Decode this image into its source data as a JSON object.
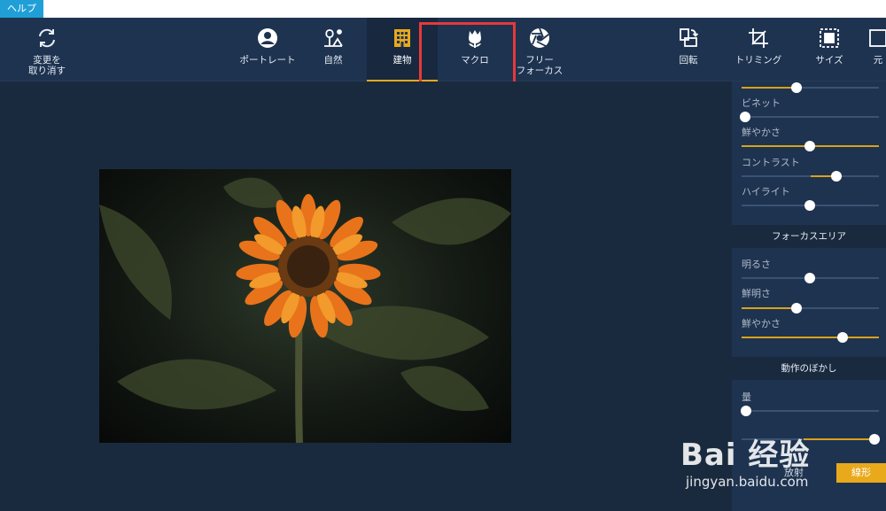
{
  "topbar": {
    "help_tab": "ヘルプ"
  },
  "toolbar": {
    "undo_label": "変更を\n取り消す",
    "tools": [
      {
        "label": "ポートレート",
        "icon": "portrait-icon"
      },
      {
        "label": "自然",
        "icon": "nature-icon"
      },
      {
        "label": "建物",
        "icon": "building-icon",
        "active": true
      },
      {
        "label": "マクロ",
        "icon": "macro-flower-icon"
      },
      {
        "label": "フリー\nフォーカス",
        "icon": "aperture-icon"
      }
    ],
    "rotate_label": "回転",
    "trim_label": "トリミング",
    "size_label": "サイズ",
    "original_label": "元"
  },
  "panel": {
    "top_sliders": [
      {
        "label": "ビネット",
        "value": 0.0
      },
      {
        "label": "鮮やかさ",
        "value": 0.5
      },
      {
        "label": "コントラスト",
        "value": 0.7
      },
      {
        "label": "ハイライト",
        "value": 0.5
      }
    ],
    "focus_area": {
      "title": "フォーカスエリア",
      "sliders": [
        {
          "label": "明るさ",
          "value": 0.5
        },
        {
          "label": "鮮明さ",
          "value": 0.4
        },
        {
          "label": "鮮やかさ",
          "value": 0.74
        }
      ]
    },
    "motion_blur": {
      "title": "動作のぼかし",
      "sliders": [
        {
          "label": "量",
          "value": 0.03
        }
      ],
      "mode_options": [
        "放射",
        "線形"
      ],
      "selected_mode": "線形"
    }
  },
  "watermark": {
    "brand": "Bai 经验",
    "url": "jingyan.baidu.com"
  },
  "colors": {
    "accent": "#e8a91b",
    "highlight_box": "#e8383a",
    "toolbar_bg": "#1e3350"
  }
}
